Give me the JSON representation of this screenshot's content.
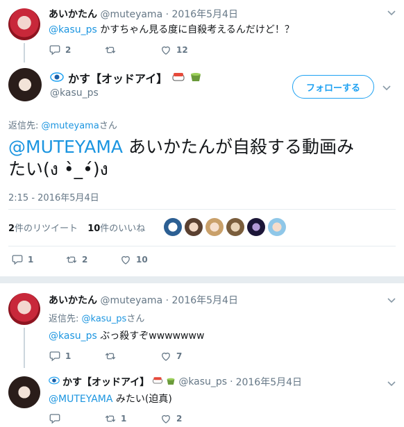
{
  "tweet1": {
    "name": "あいかたん",
    "handle": "@muteyama",
    "sep": "·",
    "date": "2016年5月4日",
    "mention": "@kasu_ps",
    "text": " かすちゃん見る度に自殺考えるんだけど！？",
    "reply_count": "2",
    "retweet_count": "",
    "like_count": "12"
  },
  "main": {
    "name": "かす【オッドアイ】",
    "handle": "@kasu_ps",
    "follow_label": "フォローする",
    "reply_to_prefix": "返信先: ",
    "reply_to_user": "@muteyama",
    "reply_to_suffix": "さん",
    "mention": "@MUTEYAMA",
    "text_line1": " あいかたんが自殺する動画み",
    "text_line2": "たい(ง •̀_•́)ง",
    "timestamp": "2:15 - 2016年5月4日",
    "rt_count": "2",
    "rt_label": "件のリツイート",
    "like_count": "10",
    "like_label": "件のいいね",
    "reply_count": "1",
    "retweet_count": "2",
    "likes_count_action": "10"
  },
  "reply1": {
    "name": "あいかたん",
    "handle": "@muteyama",
    "sep": "·",
    "date": "2016年5月4日",
    "reply_to_prefix": "返信先: ",
    "reply_to_user": "@kasu_ps",
    "reply_to_suffix": "さん",
    "mention": "@kasu_ps",
    "text": " ぶっ殺すぞwwwwwww",
    "reply_count": "1",
    "retweet_count": "",
    "like_count": "7"
  },
  "reply2": {
    "name": "かす【オッドアイ】",
    "handle": "@kasu_ps",
    "sep": "·",
    "date": "2016年5月4日",
    "mention": "@MUTEYAMA",
    "text": " みたい(迫真)",
    "reply_count": "",
    "retweet_count": "1",
    "like_count": "2"
  },
  "icons": {
    "reply": "reply-icon",
    "retweet": "retweet-icon",
    "like": "heart-icon",
    "more": "chevron-down-icon",
    "eye": "eye-icon"
  },
  "colors": {
    "link": "#1b95e0",
    "muted": "#657786",
    "follow": "#1da1f2"
  }
}
